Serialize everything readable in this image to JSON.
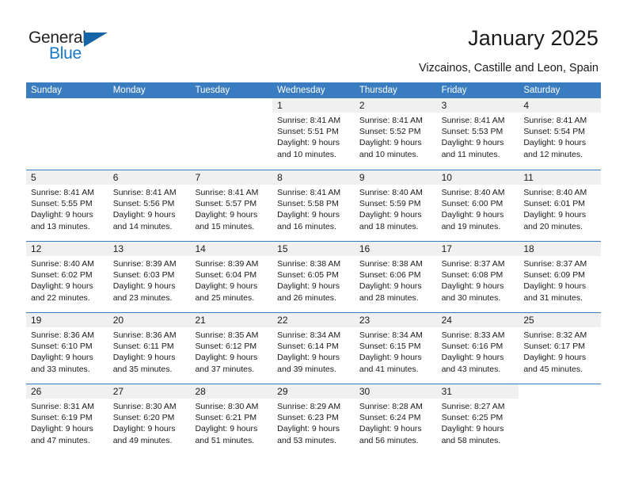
{
  "brand": {
    "name_part1": "General",
    "name_part2": "Blue",
    "triangle_color": "#1464aa",
    "blue_color": "#1878c8"
  },
  "header": {
    "title": "January 2025",
    "subtitle": "Vizcainos, Castille and Leon, Spain"
  },
  "theme": {
    "header_blue": "#3a7cc0",
    "day_strip_gray": "#f0f0f0",
    "text_color": "#1a1a1a"
  },
  "weekdays": [
    "Sunday",
    "Monday",
    "Tuesday",
    "Wednesday",
    "Thursday",
    "Friday",
    "Saturday"
  ],
  "weeks": [
    [
      {
        "blank": true
      },
      {
        "blank": true
      },
      {
        "blank": true
      },
      {
        "day": "1",
        "sunrise": "Sunrise: 8:41 AM",
        "sunset": "Sunset: 5:51 PM",
        "daylight1": "Daylight: 9 hours",
        "daylight2": "and 10 minutes."
      },
      {
        "day": "2",
        "sunrise": "Sunrise: 8:41 AM",
        "sunset": "Sunset: 5:52 PM",
        "daylight1": "Daylight: 9 hours",
        "daylight2": "and 10 minutes."
      },
      {
        "day": "3",
        "sunrise": "Sunrise: 8:41 AM",
        "sunset": "Sunset: 5:53 PM",
        "daylight1": "Daylight: 9 hours",
        "daylight2": "and 11 minutes."
      },
      {
        "day": "4",
        "sunrise": "Sunrise: 8:41 AM",
        "sunset": "Sunset: 5:54 PM",
        "daylight1": "Daylight: 9 hours",
        "daylight2": "and 12 minutes."
      }
    ],
    [
      {
        "day": "5",
        "sunrise": "Sunrise: 8:41 AM",
        "sunset": "Sunset: 5:55 PM",
        "daylight1": "Daylight: 9 hours",
        "daylight2": "and 13 minutes."
      },
      {
        "day": "6",
        "sunrise": "Sunrise: 8:41 AM",
        "sunset": "Sunset: 5:56 PM",
        "daylight1": "Daylight: 9 hours",
        "daylight2": "and 14 minutes."
      },
      {
        "day": "7",
        "sunrise": "Sunrise: 8:41 AM",
        "sunset": "Sunset: 5:57 PM",
        "daylight1": "Daylight: 9 hours",
        "daylight2": "and 15 minutes."
      },
      {
        "day": "8",
        "sunrise": "Sunrise: 8:41 AM",
        "sunset": "Sunset: 5:58 PM",
        "daylight1": "Daylight: 9 hours",
        "daylight2": "and 16 minutes."
      },
      {
        "day": "9",
        "sunrise": "Sunrise: 8:40 AM",
        "sunset": "Sunset: 5:59 PM",
        "daylight1": "Daylight: 9 hours",
        "daylight2": "and 18 minutes."
      },
      {
        "day": "10",
        "sunrise": "Sunrise: 8:40 AM",
        "sunset": "Sunset: 6:00 PM",
        "daylight1": "Daylight: 9 hours",
        "daylight2": "and 19 minutes."
      },
      {
        "day": "11",
        "sunrise": "Sunrise: 8:40 AM",
        "sunset": "Sunset: 6:01 PM",
        "daylight1": "Daylight: 9 hours",
        "daylight2": "and 20 minutes."
      }
    ],
    [
      {
        "day": "12",
        "sunrise": "Sunrise: 8:40 AM",
        "sunset": "Sunset: 6:02 PM",
        "daylight1": "Daylight: 9 hours",
        "daylight2": "and 22 minutes."
      },
      {
        "day": "13",
        "sunrise": "Sunrise: 8:39 AM",
        "sunset": "Sunset: 6:03 PM",
        "daylight1": "Daylight: 9 hours",
        "daylight2": "and 23 minutes."
      },
      {
        "day": "14",
        "sunrise": "Sunrise: 8:39 AM",
        "sunset": "Sunset: 6:04 PM",
        "daylight1": "Daylight: 9 hours",
        "daylight2": "and 25 minutes."
      },
      {
        "day": "15",
        "sunrise": "Sunrise: 8:38 AM",
        "sunset": "Sunset: 6:05 PM",
        "daylight1": "Daylight: 9 hours",
        "daylight2": "and 26 minutes."
      },
      {
        "day": "16",
        "sunrise": "Sunrise: 8:38 AM",
        "sunset": "Sunset: 6:06 PM",
        "daylight1": "Daylight: 9 hours",
        "daylight2": "and 28 minutes."
      },
      {
        "day": "17",
        "sunrise": "Sunrise: 8:37 AM",
        "sunset": "Sunset: 6:08 PM",
        "daylight1": "Daylight: 9 hours",
        "daylight2": "and 30 minutes."
      },
      {
        "day": "18",
        "sunrise": "Sunrise: 8:37 AM",
        "sunset": "Sunset: 6:09 PM",
        "daylight1": "Daylight: 9 hours",
        "daylight2": "and 31 minutes."
      }
    ],
    [
      {
        "day": "19",
        "sunrise": "Sunrise: 8:36 AM",
        "sunset": "Sunset: 6:10 PM",
        "daylight1": "Daylight: 9 hours",
        "daylight2": "and 33 minutes."
      },
      {
        "day": "20",
        "sunrise": "Sunrise: 8:36 AM",
        "sunset": "Sunset: 6:11 PM",
        "daylight1": "Daylight: 9 hours",
        "daylight2": "and 35 minutes."
      },
      {
        "day": "21",
        "sunrise": "Sunrise: 8:35 AM",
        "sunset": "Sunset: 6:12 PM",
        "daylight1": "Daylight: 9 hours",
        "daylight2": "and 37 minutes."
      },
      {
        "day": "22",
        "sunrise": "Sunrise: 8:34 AM",
        "sunset": "Sunset: 6:14 PM",
        "daylight1": "Daylight: 9 hours",
        "daylight2": "and 39 minutes."
      },
      {
        "day": "23",
        "sunrise": "Sunrise: 8:34 AM",
        "sunset": "Sunset: 6:15 PM",
        "daylight1": "Daylight: 9 hours",
        "daylight2": "and 41 minutes."
      },
      {
        "day": "24",
        "sunrise": "Sunrise: 8:33 AM",
        "sunset": "Sunset: 6:16 PM",
        "daylight1": "Daylight: 9 hours",
        "daylight2": "and 43 minutes."
      },
      {
        "day": "25",
        "sunrise": "Sunrise: 8:32 AM",
        "sunset": "Sunset: 6:17 PM",
        "daylight1": "Daylight: 9 hours",
        "daylight2": "and 45 minutes."
      }
    ],
    [
      {
        "day": "26",
        "sunrise": "Sunrise: 8:31 AM",
        "sunset": "Sunset: 6:19 PM",
        "daylight1": "Daylight: 9 hours",
        "daylight2": "and 47 minutes."
      },
      {
        "day": "27",
        "sunrise": "Sunrise: 8:30 AM",
        "sunset": "Sunset: 6:20 PM",
        "daylight1": "Daylight: 9 hours",
        "daylight2": "and 49 minutes."
      },
      {
        "day": "28",
        "sunrise": "Sunrise: 8:30 AM",
        "sunset": "Sunset: 6:21 PM",
        "daylight1": "Daylight: 9 hours",
        "daylight2": "and 51 minutes."
      },
      {
        "day": "29",
        "sunrise": "Sunrise: 8:29 AM",
        "sunset": "Sunset: 6:23 PM",
        "daylight1": "Daylight: 9 hours",
        "daylight2": "and 53 minutes."
      },
      {
        "day": "30",
        "sunrise": "Sunrise: 8:28 AM",
        "sunset": "Sunset: 6:24 PM",
        "daylight1": "Daylight: 9 hours",
        "daylight2": "and 56 minutes."
      },
      {
        "day": "31",
        "sunrise": "Sunrise: 8:27 AM",
        "sunset": "Sunset: 6:25 PM",
        "daylight1": "Daylight: 9 hours",
        "daylight2": "and 58 minutes."
      },
      {
        "blank": true
      }
    ]
  ]
}
